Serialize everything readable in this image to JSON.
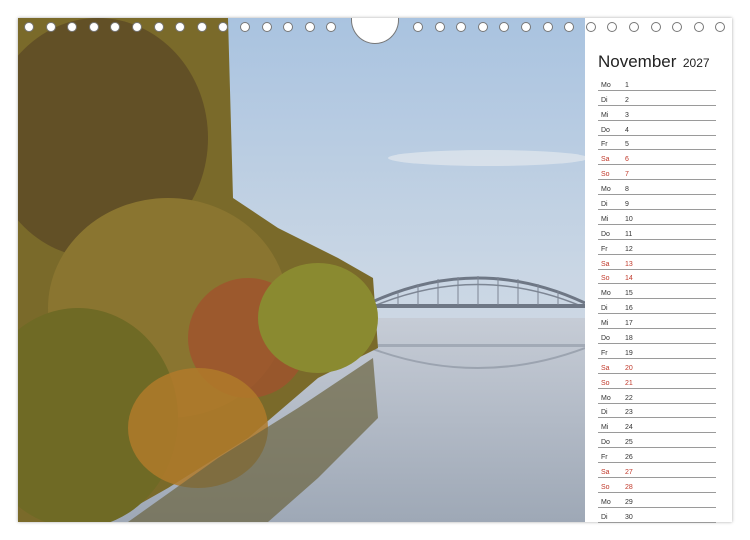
{
  "calendar": {
    "month": "November",
    "year": "2027",
    "days": [
      {
        "wd": "Mo",
        "d": "1",
        "we": false
      },
      {
        "wd": "Di",
        "d": "2",
        "we": false
      },
      {
        "wd": "Mi",
        "d": "3",
        "we": false
      },
      {
        "wd": "Do",
        "d": "4",
        "we": false
      },
      {
        "wd": "Fr",
        "d": "5",
        "we": false
      },
      {
        "wd": "Sa",
        "d": "6",
        "we": true
      },
      {
        "wd": "So",
        "d": "7",
        "we": true
      },
      {
        "wd": "Mo",
        "d": "8",
        "we": false
      },
      {
        "wd": "Di",
        "d": "9",
        "we": false
      },
      {
        "wd": "Mi",
        "d": "10",
        "we": false
      },
      {
        "wd": "Do",
        "d": "11",
        "we": false
      },
      {
        "wd": "Fr",
        "d": "12",
        "we": false
      },
      {
        "wd": "Sa",
        "d": "13",
        "we": true
      },
      {
        "wd": "So",
        "d": "14",
        "we": true
      },
      {
        "wd": "Mo",
        "d": "15",
        "we": false
      },
      {
        "wd": "Di",
        "d": "16",
        "we": false
      },
      {
        "wd": "Mi",
        "d": "17",
        "we": false
      },
      {
        "wd": "Do",
        "d": "18",
        "we": false
      },
      {
        "wd": "Fr",
        "d": "19",
        "we": false
      },
      {
        "wd": "Sa",
        "d": "20",
        "we": true
      },
      {
        "wd": "So",
        "d": "21",
        "we": true
      },
      {
        "wd": "Mo",
        "d": "22",
        "we": false
      },
      {
        "wd": "Di",
        "d": "23",
        "we": false
      },
      {
        "wd": "Mi",
        "d": "24",
        "we": false
      },
      {
        "wd": "Do",
        "d": "25",
        "we": false
      },
      {
        "wd": "Fr",
        "d": "26",
        "we": false
      },
      {
        "wd": "Sa",
        "d": "27",
        "we": true
      },
      {
        "wd": "So",
        "d": "28",
        "we": true
      },
      {
        "wd": "Mo",
        "d": "29",
        "we": false
      },
      {
        "wd": "Di",
        "d": "30",
        "we": false
      }
    ]
  },
  "colors": {
    "weekend": "#c0392b",
    "text": "#333333"
  }
}
